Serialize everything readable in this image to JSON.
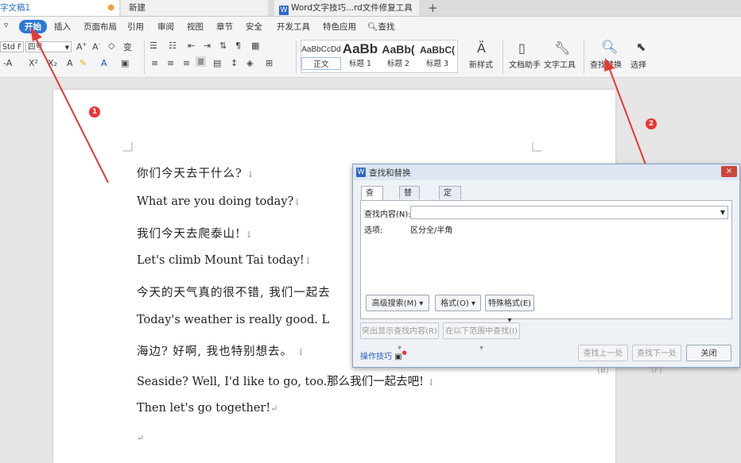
{
  "tabs": [
    {
      "label": "字文稿1"
    },
    {
      "label": "新建"
    },
    {
      "label": "Word文字技巧...rd文件修复工具"
    }
  ],
  "new_tab": "+",
  "menu": {
    "collapse": "▿",
    "items": [
      "开始",
      "插入",
      "页面布局",
      "引用",
      "审阅",
      "视图",
      "章节",
      "安全",
      "开发工具",
      "特色应用"
    ],
    "search": "查找"
  },
  "ribbon": {
    "font_name": "Std F",
    "font_size": "四号",
    "styles": [
      {
        "preview": "AaBbCcDd",
        "label": "正文"
      },
      {
        "preview": "AaBb",
        "label": "标题 1"
      },
      {
        "preview": "AaBb(",
        "label": "标题 2"
      },
      {
        "preview": "AaBbC(",
        "label": "标题 3"
      }
    ],
    "new_style": "新样式",
    "doc_assistant": "文档助手",
    "text_tools": "文字工具",
    "find_replace": "查找替换",
    "select": "选择"
  },
  "document": {
    "lines": [
      {
        "text": "你们今天去干什么?",
        "mark": "↓"
      },
      {
        "text": "What are you doing today?",
        "mark": "↓"
      },
      {
        "text": "我们今天去爬泰山!",
        "mark": "↓"
      },
      {
        "text": "Let's climb Mount Tai today!",
        "mark": "↓"
      },
      {
        "text": "今天的天气真的很不错, 我们一起去",
        "mark": ""
      },
      {
        "text": "Today's weather is really good. L",
        "mark": ""
      },
      {
        "text": "海边? 好啊, 我也特别想去。",
        "mark": "↓"
      },
      {
        "text": "Seaside? Well, I'd like to go, too.那么我们一起去吧!",
        "mark": "↓"
      },
      {
        "text": "Then let's go together!",
        "mark": "↵"
      },
      {
        "text": "",
        "mark": "↵"
      }
    ]
  },
  "annotations": {
    "badge1": "1",
    "badge2": "2",
    "color": "#e53935"
  },
  "dialog": {
    "title": "查找和替换",
    "close": "×",
    "tabs": [
      "查找(D)",
      "替换(P)",
      "定位(G)"
    ],
    "find_label": "查找内容(N):",
    "find_value": "",
    "options_label": "选项:",
    "options_value": "区分全/半角",
    "advanced_btn": "高级搜索(M) ▾",
    "format_btn": "格式(O) ▾",
    "special_btn": "特殊格式(E) ▾",
    "highlight_btn": "突出显示查找内容(R) ▾",
    "range_btn": "在以下范围中查找(I) ▾",
    "tips_link": "操作技巧",
    "prev_btn": "查找上一处(B)",
    "next_btn": "查找下一处(F)",
    "close_btn": "关闭"
  }
}
